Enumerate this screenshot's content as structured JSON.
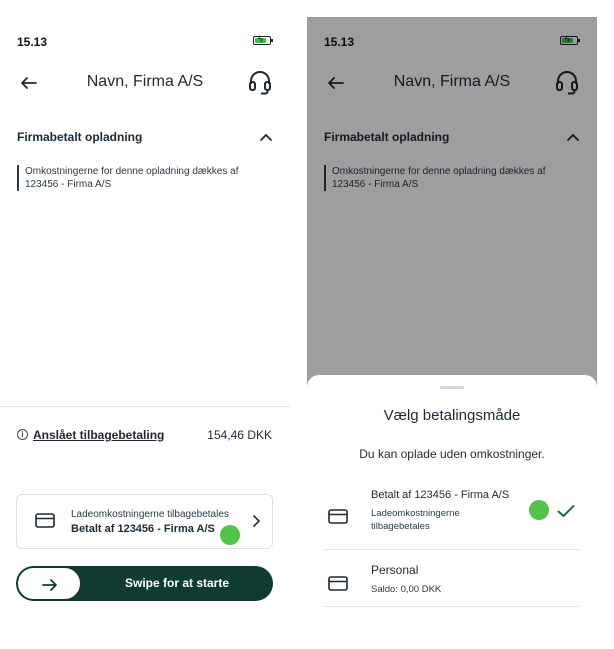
{
  "status_bar": {
    "time": "15.13",
    "battery_level": 0.75
  },
  "header": {
    "title": "Navn, Firma A/S"
  },
  "section": {
    "title": "Firmabetalt opladning",
    "info": "Omkostningerne for denne opladning dækkes af 123456 - Firma A/S"
  },
  "refund": {
    "label": "Anslået tilbagebetaling",
    "value": "154,46 DKK"
  },
  "payment_card": {
    "line1": "Ladeomkostningerne tilbagebetales",
    "line2": "Betalt af 123456 - Firma A/S"
  },
  "swipe": {
    "label": "Swipe for at starte"
  },
  "sheet": {
    "title": "Vælg betalingsmåde",
    "subtitle": "Du kan oplade uden omkostninger.",
    "options": [
      {
        "title": "Betalt af 123456 - Firma A/S",
        "detail": "Ladeomkostningerne tilbagebetales",
        "selected": true
      },
      {
        "title": "Personal",
        "detail": "Saldo: 0,00 DKK",
        "selected": false
      }
    ]
  },
  "colors": {
    "accent": "#0f3b33",
    "touch": "#55c24a",
    "battery": "#35c44a",
    "check": "#1a6b4e"
  },
  "icons": [
    "back-arrow-icon",
    "headset-icon",
    "chevron-up-icon",
    "info-icon",
    "credit-card-icon",
    "chevron-right-icon",
    "arrow-right-icon",
    "checkmark-icon"
  ]
}
